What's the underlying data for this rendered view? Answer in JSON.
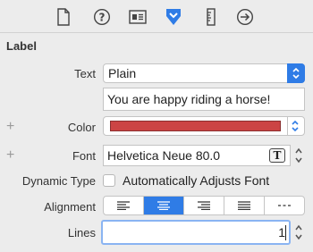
{
  "toolbar": {
    "icons": [
      "file-icon",
      "help-icon",
      "identity-icon",
      "attributes-icon",
      "ruler-icon",
      "connections-icon"
    ],
    "selected": "attributes-icon",
    "accent": "#2f7ce6"
  },
  "section": {
    "title": "Label"
  },
  "text_row": {
    "label": "Text",
    "value": "Plain"
  },
  "text_field": {
    "value": "You are happy riding a horse!"
  },
  "color_row": {
    "label": "Color",
    "plus": "+",
    "swatch": "#cc4444"
  },
  "font_row": {
    "label": "Font",
    "plus": "+",
    "value": "Helvetica Neue 80.0",
    "picker_glyph": "T"
  },
  "dynamic_type": {
    "label": "Dynamic Type",
    "checkbox_label": "Automatically Adjusts Font",
    "checked": false
  },
  "alignment": {
    "label": "Alignment",
    "options": [
      "left",
      "center",
      "right",
      "justified",
      "natural"
    ],
    "selected": "center"
  },
  "lines": {
    "label": "Lines",
    "value": "1"
  }
}
